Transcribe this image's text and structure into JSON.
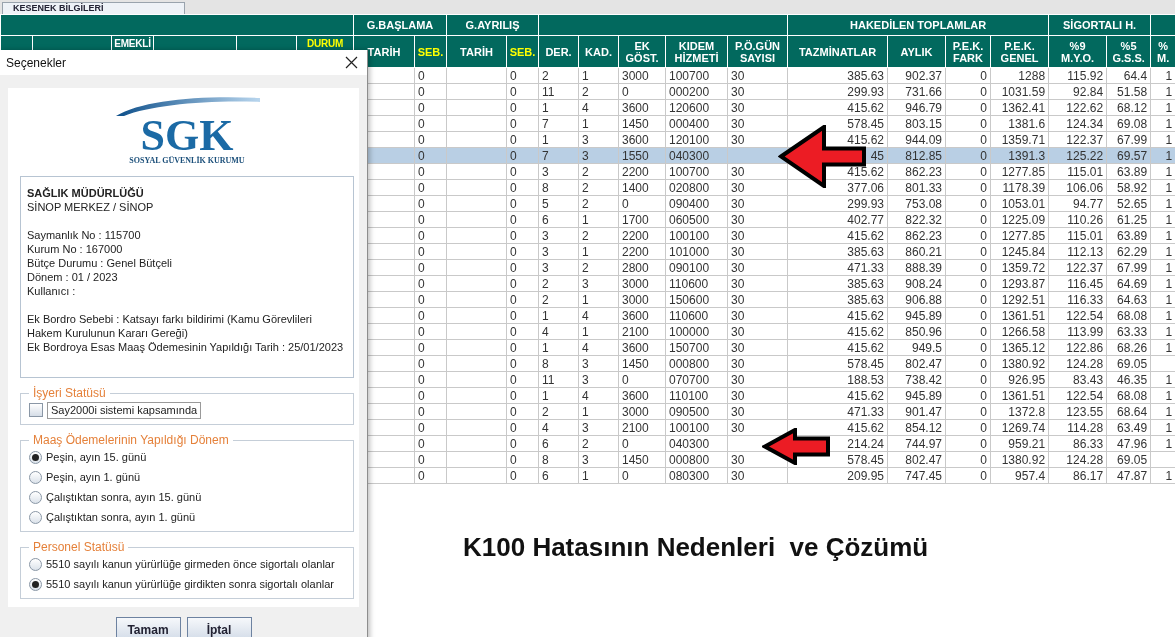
{
  "tab": {
    "label": "KESENEK BİLGİLERİ"
  },
  "table": {
    "column_groups": [
      {
        "columns": [
          {
            "kind": "plain"
          },
          {
            "kind": "plain"
          },
          {
            "label": "EMEKLİ",
            "kind": "plain"
          },
          {
            "kind": "plain"
          },
          {
            "kind": "plain"
          },
          {
            "label": "DURUM",
            "kind": "code"
          }
        ]
      },
      {
        "label": "G.BAŞLAMA",
        "columns": [
          {
            "label": "TARİH",
            "kind": "plain"
          },
          {
            "label": "SEB.",
            "kind": "code"
          }
        ]
      },
      {
        "label": "G.AYRILIŞ",
        "columns": [
          {
            "label": "TARİH",
            "kind": "plain"
          },
          {
            "label": "SEB.",
            "kind": "code"
          }
        ]
      },
      {
        "columns": [
          {
            "label": "DER.",
            "kind": "plain"
          },
          {
            "label": "KAD.",
            "kind": "plain"
          },
          {
            "label": "EK GÖST.",
            "kind": "plain"
          },
          {
            "label": "KIDEM HİZMETİ",
            "kind": "plain"
          },
          {
            "label": "P.Ö.GÜN SAYISI",
            "kind": "plain"
          }
        ]
      },
      {
        "label": "HAKEDİLEN TOPLAMLAR",
        "columns": [
          {
            "label": "TAZMİNATLAR",
            "kind": "plain"
          },
          {
            "label": "AYLIK",
            "kind": "plain"
          },
          {
            "label": "P.E.K. FARK",
            "kind": "plain"
          },
          {
            "label": "P.E.K. GENEL",
            "kind": "plain"
          }
        ]
      },
      {
        "label": "SİGORTALI H.",
        "columns": [
          {
            "label": "%9 M.Y.O.",
            "kind": "plain"
          },
          {
            "label": "%5 G.S.S.",
            "kind": "plain"
          }
        ]
      },
      {
        "columns": [
          {
            "label": "% M.",
            "kind": "plain"
          }
        ]
      }
    ],
    "rows": [
      {
        "selected": false,
        "cells": [
          null,
          "0",
          null,
          "0",
          "2",
          "1",
          "3000",
          "100700",
          "30",
          "385.63",
          "902.37",
          "0",
          "1288",
          "115.92",
          "64.4",
          "1"
        ]
      },
      {
        "selected": false,
        "cells": [
          null,
          "0",
          null,
          "0",
          "11",
          "2",
          "0",
          "000200",
          "30",
          "299.93",
          "731.66",
          "0",
          "1031.59",
          "92.84",
          "51.58",
          "1"
        ]
      },
      {
        "selected": false,
        "cells": [
          null,
          "0",
          null,
          "0",
          "1",
          "4",
          "3600",
          "120600",
          "30",
          "415.62",
          "946.79",
          "0",
          "1362.41",
          "122.62",
          "68.12",
          "1"
        ]
      },
      {
        "selected": false,
        "cells": [
          null,
          "0",
          null,
          "0",
          "7",
          "1",
          "1450",
          "000400",
          "30",
          "578.45",
          "803.15",
          "0",
          "1381.6",
          "124.34",
          "69.08",
          "1"
        ]
      },
      {
        "selected": false,
        "cells": [
          null,
          "0",
          null,
          "0",
          "1",
          "3",
          "3600",
          "120100",
          "30",
          "415.62",
          "944.09",
          "0",
          "1359.71",
          "122.37",
          "67.99",
          "1"
        ]
      },
      {
        "selected": true,
        "cells": [
          null,
          "0",
          null,
          "0",
          "7",
          "3",
          "1550",
          "040300",
          null,
          "45",
          "812.85",
          "0",
          "1391.3",
          "125.22",
          "69.57",
          "1"
        ]
      },
      {
        "selected": false,
        "cells": [
          null,
          "0",
          null,
          "0",
          "3",
          "2",
          "2200",
          "100700",
          "30",
          "415.62",
          "862.23",
          "0",
          "1277.85",
          "115.01",
          "63.89",
          "1"
        ]
      },
      {
        "selected": false,
        "cells": [
          null,
          "0",
          null,
          "0",
          "8",
          "2",
          "1400",
          "020800",
          "30",
          "377.06",
          "801.33",
          "0",
          "1178.39",
          "106.06",
          "58.92",
          "1"
        ]
      },
      {
        "selected": false,
        "cells": [
          null,
          "0",
          null,
          "0",
          "5",
          "2",
          "0",
          "090400",
          "30",
          "299.93",
          "753.08",
          "0",
          "1053.01",
          "94.77",
          "52.65",
          "1"
        ]
      },
      {
        "selected": false,
        "cells": [
          null,
          "0",
          null,
          "0",
          "6",
          "1",
          "1700",
          "060500",
          "30",
          "402.77",
          "822.32",
          "0",
          "1225.09",
          "110.26",
          "61.25",
          "1"
        ]
      },
      {
        "selected": false,
        "cells": [
          null,
          "0",
          null,
          "0",
          "3",
          "2",
          "2200",
          "100100",
          "30",
          "415.62",
          "862.23",
          "0",
          "1277.85",
          "115.01",
          "63.89",
          "1"
        ]
      },
      {
        "selected": false,
        "cells": [
          null,
          "0",
          null,
          "0",
          "3",
          "1",
          "2200",
          "101000",
          "30",
          "385.63",
          "860.21",
          "0",
          "1245.84",
          "112.13",
          "62.29",
          "1"
        ]
      },
      {
        "selected": false,
        "cells": [
          null,
          "0",
          null,
          "0",
          "3",
          "2",
          "2800",
          "090100",
          "30",
          "471.33",
          "888.39",
          "0",
          "1359.72",
          "122.37",
          "67.99",
          "1"
        ]
      },
      {
        "selected": false,
        "cells": [
          null,
          "0",
          null,
          "0",
          "2",
          "3",
          "3000",
          "110600",
          "30",
          "385.63",
          "908.24",
          "0",
          "1293.87",
          "116.45",
          "64.69",
          "1"
        ]
      },
      {
        "selected": false,
        "cells": [
          null,
          "0",
          null,
          "0",
          "2",
          "1",
          "3000",
          "150600",
          "30",
          "385.63",
          "906.88",
          "0",
          "1292.51",
          "116.33",
          "64.63",
          "1"
        ]
      },
      {
        "selected": false,
        "cells": [
          null,
          "0",
          null,
          "0",
          "1",
          "4",
          "3600",
          "110600",
          "30",
          "415.62",
          "945.89",
          "0",
          "1361.51",
          "122.54",
          "68.08",
          "1"
        ]
      },
      {
        "selected": false,
        "cells": [
          null,
          "0",
          null,
          "0",
          "4",
          "1",
          "2100",
          "100000",
          "30",
          "415.62",
          "850.96",
          "0",
          "1266.58",
          "113.99",
          "63.33",
          "1"
        ]
      },
      {
        "selected": false,
        "cells": [
          null,
          "0",
          null,
          "0",
          "1",
          "4",
          "3600",
          "150700",
          "30",
          "415.62",
          "949.5",
          "0",
          "1365.12",
          "122.86",
          "68.26",
          "1"
        ]
      },
      {
        "selected": false,
        "cells": [
          null,
          "0",
          null,
          "0",
          "8",
          "3",
          "1450",
          "000800",
          "30",
          "578.45",
          "802.47",
          "0",
          "1380.92",
          "124.28",
          "69.05",
          null
        ]
      },
      {
        "selected": false,
        "cells": [
          null,
          "0",
          null,
          "0",
          "11",
          "3",
          "0",
          "070700",
          "30",
          "188.53",
          "738.42",
          "0",
          "926.95",
          "83.43",
          "46.35",
          "1"
        ]
      },
      {
        "selected": false,
        "cells": [
          null,
          "0",
          null,
          "0",
          "1",
          "4",
          "3600",
          "110100",
          "30",
          "415.62",
          "945.89",
          "0",
          "1361.51",
          "122.54",
          "68.08",
          "1"
        ]
      },
      {
        "selected": false,
        "cells": [
          null,
          "0",
          null,
          "0",
          "2",
          "1",
          "3000",
          "090500",
          "30",
          "471.33",
          "901.47",
          "0",
          "1372.8",
          "123.55",
          "68.64",
          "1"
        ]
      },
      {
        "selected": false,
        "cells": [
          null,
          "0",
          null,
          "0",
          "4",
          "3",
          "2100",
          "100100",
          "30",
          "415.62",
          "854.12",
          "0",
          "1269.74",
          "114.28",
          "63.49",
          "1"
        ]
      },
      {
        "selected": false,
        "cells": [
          null,
          "0",
          null,
          "0",
          "6",
          "2",
          "0",
          "040300",
          null,
          "214.24",
          "744.97",
          "0",
          "959.21",
          "86.33",
          "47.96",
          "1"
        ]
      },
      {
        "selected": false,
        "cells": [
          null,
          "0",
          null,
          "0",
          "8",
          "3",
          "1450",
          "000800",
          "30",
          "578.45",
          "802.47",
          "0",
          "1380.92",
          "124.28",
          "69.05",
          null
        ]
      },
      {
        "selected": false,
        "cells": [
          null,
          "0",
          null,
          "0",
          "6",
          "1",
          "0",
          "080300",
          "30",
          "209.95",
          "747.45",
          "0",
          "957.4",
          "86.17",
          "47.87",
          "1"
        ]
      }
    ]
  },
  "caption": "K100 Hatasının Nedenleri  ve Çözümü",
  "dialog": {
    "title": "Seçenekler",
    "logo": {
      "text": "SGK",
      "subtitle": "SOSYAL GÜVENLİK KURUMU"
    },
    "info": {
      "heading": "SAĞLIK MÜDÜRLÜĞÜ",
      "subheading": "SİNOP MERKEZ / SİNOP",
      "details": [
        "Saymanlık No : 115700",
        "Kurum No : 167000",
        "Bütçe Durumu : Genel Bütçeli",
        "Dönem : 01 / 2023",
        "Kullanıcı :"
      ],
      "notes": [
        "Ek Bordro Sebebi : Katsayı farkı bildirimi (Kamu Görevlileri Hakem Kurulunun Kararı Gereği)",
        "Ek Bordroya Esas Maaş Ödemesinin Yapıldığı Tarih : 25/01/2023"
      ]
    },
    "sections": [
      {
        "title": "İşyeri Statüsü",
        "kind": "checkbox",
        "options": [
          {
            "label": "Say2000i sistemi kapsamında",
            "checked": false
          }
        ]
      },
      {
        "title": "Maaş Ödemelerinin Yapıldığı Dönem",
        "kind": "radio",
        "options": [
          {
            "label": "Peşin, ayın 15. günü",
            "selected": true
          },
          {
            "label": "Peşin, ayın 1. günü",
            "selected": false
          },
          {
            "label": "Çalıştıktan sonra, ayın 15. günü",
            "selected": false
          },
          {
            "label": "Çalıştıktan sonra, ayın 1. günü",
            "selected": false
          }
        ]
      },
      {
        "title": "Personel Statüsü",
        "kind": "radio",
        "options": [
          {
            "label": "5510 sayılı kanun yürürlüğe girmeden önce sigortalı olanlar",
            "selected": false
          },
          {
            "label": "5510 sayılı kanun yürürlüğe girdikten sonra sigortalı olanlar",
            "selected": true
          }
        ]
      }
    ],
    "buttons": [
      "Tamam",
      "İptal"
    ]
  }
}
